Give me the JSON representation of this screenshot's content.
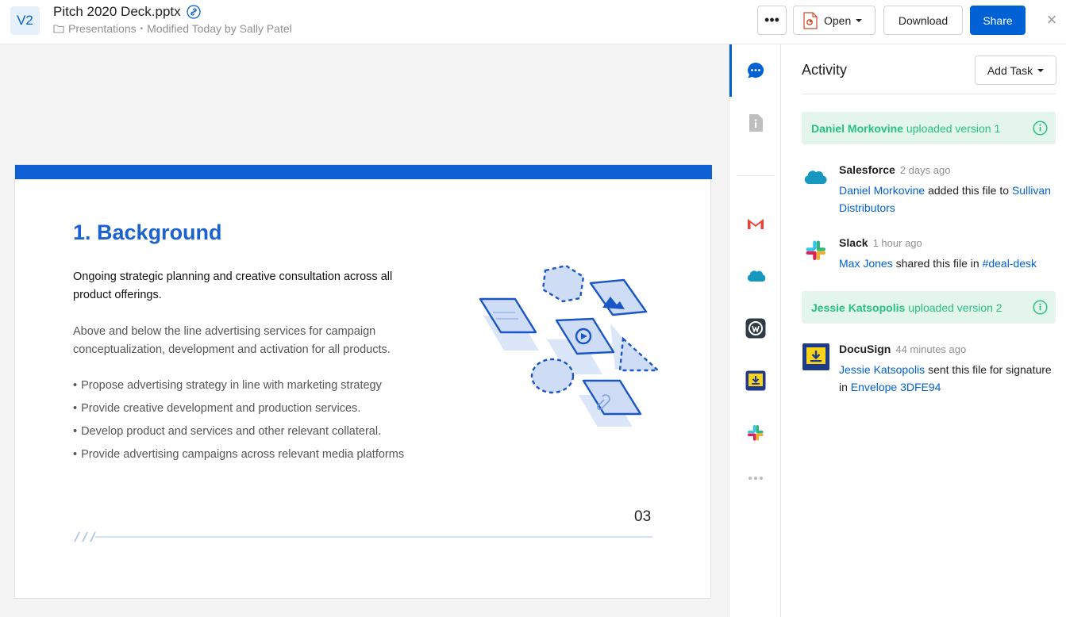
{
  "header": {
    "version_badge": "V2",
    "file_name": "Pitch 2020 Deck.pptx",
    "folder": "Presentations",
    "separator": "•",
    "modified": "Modified Today by Sally Patel",
    "more_label": "•••",
    "open_label": "Open",
    "download_label": "Download",
    "share_label": "Share",
    "close_label": "×"
  },
  "slide": {
    "heading": "1. Background",
    "lead": "Ongoing strategic planning and creative consultation across all product offerings.",
    "body": "Above and below the line advertising services for campaign conceptualization, development and activation for all products.",
    "bullets": [
      "Propose advertising strategy in line with marketing strategy",
      "Provide creative development and production services.",
      "Develop product and services and other relevant collateral.",
      "Provide advertising campaigns across relevant media platforms"
    ],
    "page_number": "03"
  },
  "sidenav": {
    "icons": [
      "chat-icon",
      "info-icon",
      "gmail-icon",
      "salesforce-icon",
      "workplace-icon",
      "docusign-icon",
      "slack-icon",
      "more-icon"
    ]
  },
  "activity": {
    "title": "Activity",
    "add_task_label": "Add Task",
    "version_notes": [
      {
        "who": "Daniel Morkovine",
        "action": "uploaded version 1"
      },
      {
        "who": "Jessie Katsopolis",
        "action": "uploaded version 2"
      }
    ],
    "events": [
      {
        "app": "Salesforce",
        "time": "2 days ago",
        "actor": "Daniel Morkovine",
        "verb": "added this file to",
        "target": "Sullivan Distributors"
      },
      {
        "app": "Slack",
        "time": "1 hour ago",
        "actor": "Max Jones",
        "verb": "shared this file in",
        "target": "#deal-desk"
      },
      {
        "app": "DocuSign",
        "time": "44 minutes ago",
        "actor": "Jessie Katsopolis",
        "verb": "sent this file for signature in",
        "target": "Envelope 3DFE94"
      }
    ]
  },
  "colors": {
    "accent": "#0061d5",
    "success": "#26c281",
    "success_bg": "#e4f6ec",
    "slide_blue": "#1a62d0"
  }
}
